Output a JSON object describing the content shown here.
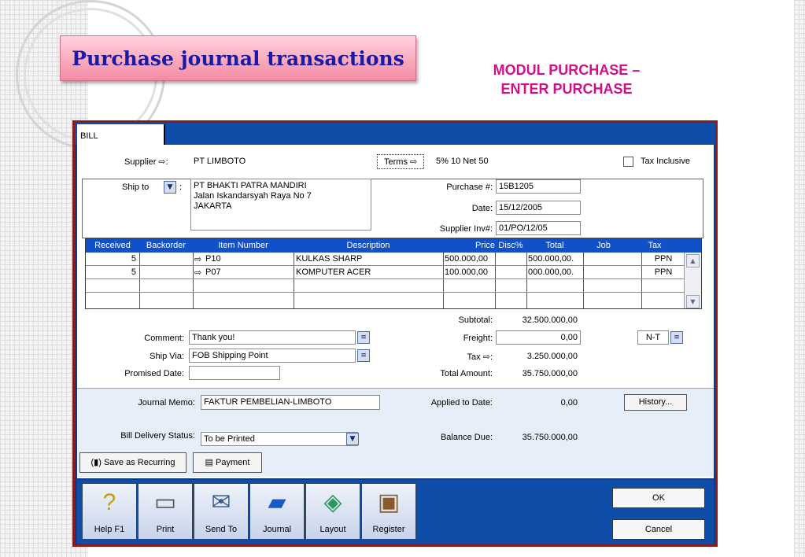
{
  "slide": {
    "title": "Purchase journal transactions",
    "subtitle_line1": "MODUL PURCHASE –",
    "subtitle_line2": "ENTER PURCHASE"
  },
  "window": {
    "tab_label": "BILL",
    "supplier_label": "Supplier",
    "supplier_value": "PT LIMBOTO",
    "terms_label": "Terms",
    "terms_value": "5% 10 Net 50",
    "tax_inclusive_label": "Tax Inclusive",
    "ship_to_label": "Ship to",
    "ship_to_lines": [
      "PT BHAKTI PATRA MANDIRI",
      "Jalan Iskandarsyah Raya No 7",
      "JAKARTA"
    ],
    "purchase_no_label": "Purchase #:",
    "purchase_no_value": "15B1205",
    "date_label": "Date:",
    "date_value": "15/12/2005",
    "supplier_inv_label": "Supplier Inv#:",
    "supplier_inv_value": "01/PO/12/05"
  },
  "grid": {
    "headers": [
      "Received",
      "Backorder",
      "Item Number",
      "Description",
      "Price",
      "Disc%",
      "Total",
      "Job",
      "Tax"
    ],
    "rows": [
      {
        "received": "5",
        "backorder": "",
        "item": "P10",
        "description": "KULKAS SHARP",
        "price": "500.000,00",
        "disc": "",
        "total": ".500.000,00",
        "job": "",
        "tax": "PPN"
      },
      {
        "received": "5",
        "backorder": "",
        "item": "P07",
        "description": "KOMPUTER ACER",
        "price": "100.000,00",
        "disc": "",
        "total": ".000.000,00",
        "job": "",
        "tax": "PPN"
      }
    ]
  },
  "totals": {
    "subtotal_label": "Subtotal:",
    "subtotal_value": "32.500.000,00",
    "freight_label": "Freight:",
    "freight_value": "0,00",
    "freight_tax": "N-T",
    "tax_label": "Tax",
    "tax_value": "3.250.000,00",
    "total_label": "Total Amount:",
    "total_value": "35.750.000,00"
  },
  "details": {
    "comment_label": "Comment:",
    "comment_value": "Thank you!",
    "ship_via_label": "Ship Via:",
    "ship_via_value": "FOB Shipping Point",
    "promised_label": "Promised Date:",
    "promised_value": ""
  },
  "lower": {
    "journal_memo_label": "Journal Memo:",
    "journal_memo_value": "FAKTUR PEMBELIAN-LIMBOTO",
    "applied_label": "Applied to Date:",
    "applied_value": "0,00",
    "history_label": "History...",
    "delivery_label": "Bill Delivery Status:",
    "delivery_value": "To be Printed",
    "balance_label": "Balance Due:",
    "balance_value": "35.750.000,00",
    "save_recurring_label": "Save as Recurring",
    "payment_label": "Payment"
  },
  "toolbar": {
    "buttons": [
      {
        "label": "Help F1",
        "icon": "help-icon"
      },
      {
        "label": "Print",
        "icon": "printer-icon"
      },
      {
        "label": "Send To",
        "icon": "mailbox-icon"
      },
      {
        "label": "Journal",
        "icon": "journal-icon"
      },
      {
        "label": "Layout",
        "icon": "layout-icon"
      },
      {
        "label": "Register",
        "icon": "register-icon"
      }
    ],
    "ok_label": "OK",
    "cancel_label": "Cancel"
  },
  "colors": {
    "accent": "#0f4ea8",
    "title_text": "#1a1aa6",
    "subtitle_text": "#d0108a",
    "frame": "#8c1a1a"
  }
}
